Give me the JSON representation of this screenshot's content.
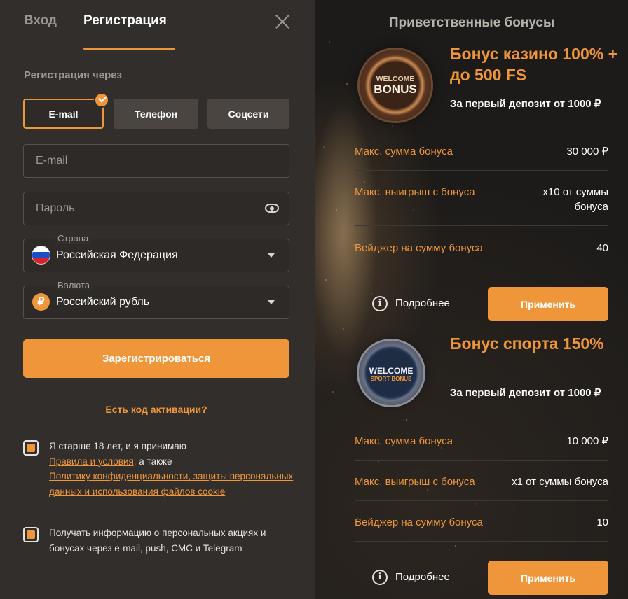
{
  "tabs": {
    "login": "Вход",
    "register": "Регистрация"
  },
  "form": {
    "reg_via_label": "Регистрация через",
    "methods": {
      "email": "E-mail",
      "phone": "Телефон",
      "social": "Соцсети"
    },
    "email_placeholder": "E-mail",
    "password_placeholder": "Пароль",
    "country_label": "Страна",
    "country_value": "Российская Федерация",
    "currency_label": "Валюта",
    "currency_value": "Российский рубль",
    "currency_symbol": "₽",
    "register_button": "Зарегистрироваться",
    "activation_link": "Есть код активации?",
    "consent_age_text": "Я старше 18 лет, и я принимаю",
    "consent_terms_link": "Правила и условия,",
    "consent_also": "а также",
    "consent_privacy_link": "Политику конфиденциальности, защиты персональных данных и использования файлов cookie",
    "consent_marketing": "Получать информацию о персональных акциях и бонусах через e-mail, push, СМС и Telegram"
  },
  "bonuses": {
    "title": "Приветственные бонусы",
    "casino": {
      "coin_top": "WELCOME",
      "coin_main": "BONUS",
      "title": "Бонус казино 100% + до 500 FS",
      "subtitle": "За первый депозит от 1000 ₽",
      "rows": [
        {
          "key": "Макс. сумма бонуса",
          "value": "30 000 ₽"
        },
        {
          "key": "Макс. выигрыш с бонуса",
          "value": "x10 от суммы бонуса"
        },
        {
          "key": "Вейджер на сумму бонуса",
          "value": "40"
        }
      ],
      "more": "Подробнее",
      "apply": "Применить"
    },
    "sport": {
      "coin_top": "WELCOME",
      "coin_main": "SPORT BONUS",
      "title": "Бонус спорта 150%",
      "subtitle": "За первый депозит от 1000 ₽",
      "rows": [
        {
          "key": "Макс. сумма бонуса",
          "value": "10 000 ₽"
        },
        {
          "key": "Макс. выигрыш с бонуса",
          "value": "x1 от суммы бонуса"
        },
        {
          "key": "Вейджер на сумму бонуса",
          "value": "10"
        }
      ],
      "more": "Подробнее",
      "apply": "Применить"
    }
  },
  "colors": {
    "accent": "#f0963a",
    "panel": "#322e2b",
    "bg": "#1d1b19"
  }
}
